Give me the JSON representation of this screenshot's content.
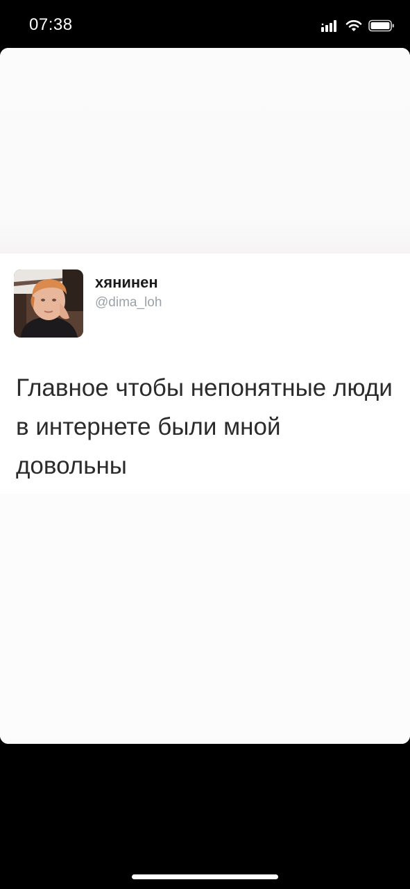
{
  "status_bar": {
    "time": "07:38",
    "icons": [
      "signal-icon",
      "wifi-icon",
      "battery-icon"
    ],
    "text_color": "#ffffff"
  },
  "tweet": {
    "display_name": "хянинен",
    "handle": "@dima_loh",
    "text": "Главное чтобы непонятные люди в интернете были мной довольны",
    "avatar": "profile-photo"
  },
  "colors": {
    "background": "#000000",
    "card": "#fdfdfd",
    "name": "#1a1a1a",
    "handle": "#9aa1a8",
    "body_text": "#2b2b2b"
  }
}
